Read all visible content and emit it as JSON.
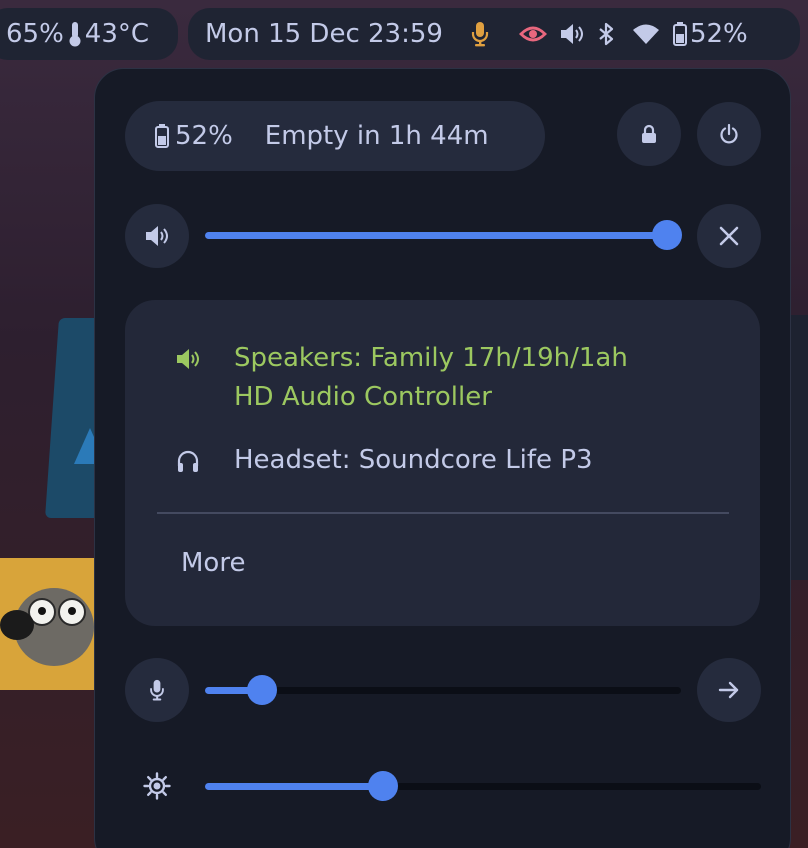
{
  "topbar": {
    "cpu_percent": "65%",
    "temperature": "43°C",
    "clock": "Mon 15 Dec 23:59",
    "battery_percent": "52%",
    "icons": [
      "thermometer-icon",
      "microphone-icon",
      "eye-icon",
      "volume-icon",
      "bluetooth-icon",
      "wifi-icon",
      "battery-icon"
    ]
  },
  "panel": {
    "battery": {
      "percent": "52%",
      "status": "Empty in 1h 44m"
    },
    "buttons": {
      "lock_icon": "lock-icon",
      "power_icon": "power-icon",
      "close_icon": "close-icon",
      "arrow_icon": "arrow-right-icon"
    },
    "volume_slider": {
      "icon": "volume-icon",
      "level": 1.0
    },
    "audio_outputs": [
      {
        "label_line1": "Speakers: Family 17h/19h/1ah",
        "label_line2": "HD Audio Controller",
        "icon": "speaker-icon",
        "active": true
      },
      {
        "label": "Headset: Soundcore Life P3",
        "icon": "headset-icon",
        "active": false
      }
    ],
    "more_label": "More",
    "mic_slider": {
      "icon": "microphone-icon",
      "level": 0.12
    },
    "brightness_slider": {
      "icon": "brightness-icon",
      "level": 0.32
    }
  },
  "colors": {
    "accent": "#4f82ef",
    "active_output": "#9cc860",
    "microphone_active": "#e0a040",
    "privacy_eye": "#e8677e",
    "panel_bg": "#161a26",
    "card_bg": "#232839",
    "text": "#c3cae8"
  }
}
